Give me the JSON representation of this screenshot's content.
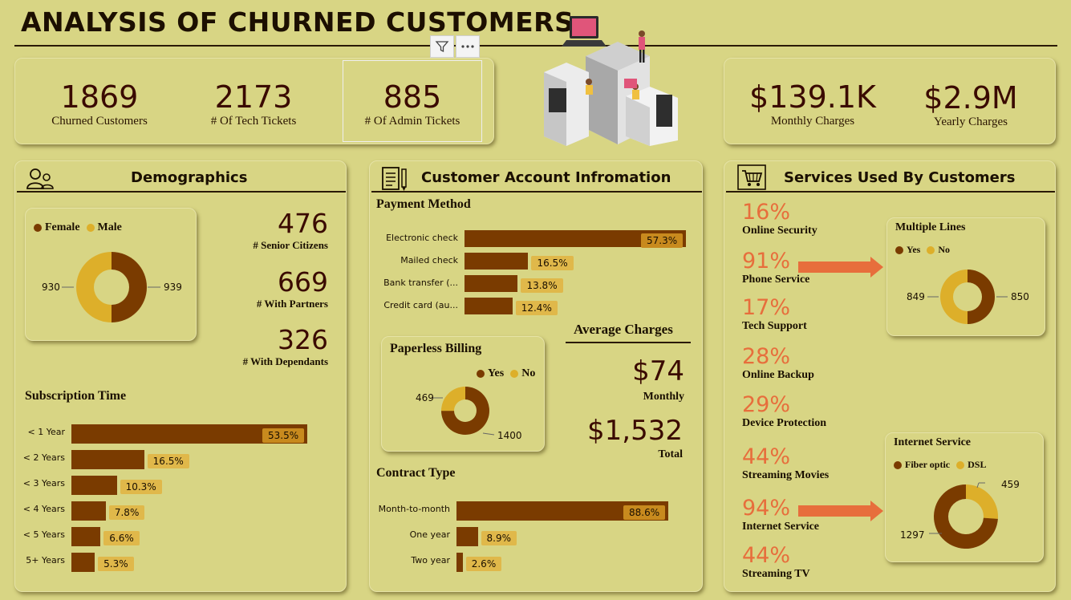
{
  "title": "ANALYSIS OF CHURNED CUSTOMERS",
  "colors": {
    "dark": "#7A3B00",
    "gold": "#DDAF2A",
    "accent": "#E76E3C",
    "background": "#D8D584"
  },
  "kpis_left": [
    {
      "value": "1869",
      "label": "Churned Customers"
    },
    {
      "value": "2173",
      "label": "# Of Tech Tickets"
    },
    {
      "value": "885",
      "label": "# Of Admin Tickets"
    }
  ],
  "kpis_right": [
    {
      "value": "$139.1K",
      "label": "Monthly Charges"
    },
    {
      "value": "$2.9M",
      "label": "Yearly Charges"
    }
  ],
  "visual_header": {
    "filter_icon": "filter-icon",
    "more_icon": "more-options-icon"
  },
  "demographics": {
    "title": "Demographics",
    "icon": "people-icon",
    "gender": {
      "legend": [
        "Female",
        "Male"
      ],
      "values": {
        "female": 939,
        "male": 930
      },
      "label_left": "930",
      "label_right": "939"
    },
    "stats": [
      {
        "value": "476",
        "label": "# Senior Citizens"
      },
      {
        "value": "669",
        "label": "# With Partners"
      },
      {
        "value": "326",
        "label": "# With Dependants"
      }
    ],
    "subscription": {
      "title": "Subscription Time",
      "rows": [
        {
          "label": "< 1 Year",
          "pct": 53.5,
          "text": "53.5%"
        },
        {
          "label": "< 2 Years",
          "pct": 16.5,
          "text": "16.5%"
        },
        {
          "label": "< 3 Years",
          "pct": 10.3,
          "text": "10.3%"
        },
        {
          "label": "< 4 Years",
          "pct": 7.8,
          "text": "7.8%"
        },
        {
          "label": "< 5 Years",
          "pct": 6.6,
          "text": "6.6%"
        },
        {
          "label": "5+ Years",
          "pct": 5.3,
          "text": "5.3%"
        }
      ]
    }
  },
  "account": {
    "title": "Customer Account Infromation",
    "icon": "document-pen-icon",
    "payment": {
      "title": "Payment Method",
      "rows": [
        {
          "label": "Electronic check",
          "pct": 57.3,
          "text": "57.3%"
        },
        {
          "label": "Mailed check",
          "pct": 16.5,
          "text": "16.5%"
        },
        {
          "label": "Bank transfer (...",
          "pct": 13.8,
          "text": "13.8%"
        },
        {
          "label": "Credit card (au...",
          "pct": 12.4,
          "text": "12.4%"
        }
      ]
    },
    "paperless": {
      "title": "Paperless Billing",
      "legend": [
        "Yes",
        "No"
      ],
      "values": {
        "yes": 1400,
        "no": 469
      },
      "label_no": "469",
      "label_yes": "1400"
    },
    "avg_charges": {
      "title": "Average Charges",
      "monthly_value": "$74",
      "monthly_label": "Monthly",
      "total_value": "$1,532",
      "total_label": "Total"
    },
    "contract": {
      "title": "Contract Type",
      "rows": [
        {
          "label": "Month-to-month",
          "pct": 88.6,
          "text": "88.6%"
        },
        {
          "label": "One year",
          "pct": 8.9,
          "text": "8.9%"
        },
        {
          "label": "Two year",
          "pct": 2.6,
          "text": "2.6%"
        }
      ]
    }
  },
  "services": {
    "title": "Services Used By Customers",
    "icon": "shopping-cart-icon",
    "items": [
      {
        "pct": "16%",
        "label": "Online Security"
      },
      {
        "pct": "91%",
        "label": "Phone Service"
      },
      {
        "pct": "17%",
        "label": "Tech Support"
      },
      {
        "pct": "28%",
        "label": "Online Backup"
      },
      {
        "pct": "29%",
        "label": "Device Protection"
      },
      {
        "pct": "44%",
        "label": "Streaming Movies"
      },
      {
        "pct": "94%",
        "label": "Internet Service"
      },
      {
        "pct": "44%",
        "label": "Streaming TV"
      }
    ],
    "multiple_lines": {
      "title": "Multiple Lines",
      "legend": [
        "Yes",
        "No"
      ],
      "values": {
        "yes": 850,
        "no": 849
      },
      "label_left": "849",
      "label_right": "850"
    },
    "internet_service": {
      "title": "Internet Service",
      "legend": [
        "Fiber optic",
        "DSL"
      ],
      "values": {
        "fiber": 1297,
        "dsl": 459
      },
      "label_fiber": "1297",
      "label_dsl": "459"
    }
  }
}
